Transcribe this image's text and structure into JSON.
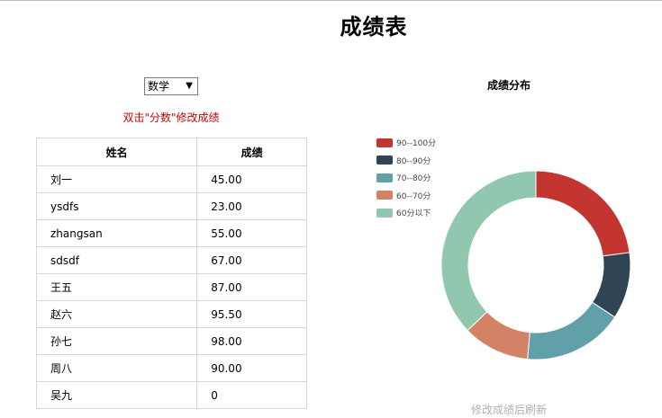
{
  "page": {
    "title": "成绩表"
  },
  "subject_select": {
    "value": "数学"
  },
  "hint": "双击\"分数\"修改成绩",
  "table": {
    "headers": [
      "姓名",
      "成绩"
    ],
    "rows": [
      [
        "刘一",
        "45.00"
      ],
      [
        "ysdfs",
        "23.00"
      ],
      [
        "zhangsan",
        "55.00"
      ],
      [
        "sdsdf",
        "67.00"
      ],
      [
        "王五",
        "87.00"
      ],
      [
        "赵六",
        "95.50"
      ],
      [
        "孙七",
        "98.00"
      ],
      [
        "周八",
        "90.00"
      ],
      [
        "吴九",
        "0"
      ]
    ]
  },
  "chart_data": {
    "type": "pie",
    "title": "成绩分布",
    "legend_placement": "top-left",
    "categories": [
      "90--100分",
      "80--90分",
      "70--80分",
      "60--70分",
      "60分以下"
    ],
    "values": [
      2.4,
      1.2,
      1.8,
      1.2,
      3.9
    ],
    "colors": [
      "#c23531",
      "#2f4554",
      "#61a0a8",
      "#d48265",
      "#91c7ae"
    ]
  },
  "refresh_note": "修改成绩后刷新"
}
